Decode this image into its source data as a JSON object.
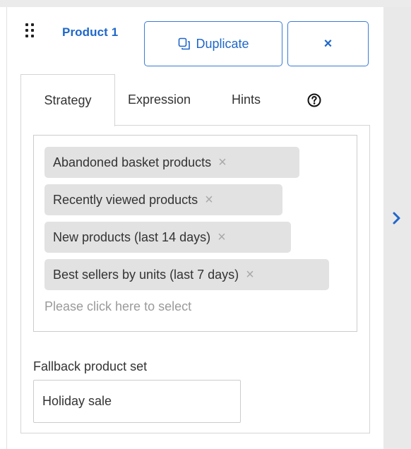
{
  "header": {
    "title": "Product 1",
    "duplicate_label": "Duplicate",
    "close_label": "×",
    "drag_icon": "drag-handle-icon",
    "duplicate_icon": "duplicate-icon"
  },
  "tabs": [
    {
      "label": "Strategy",
      "active": true
    },
    {
      "label": "Expression",
      "active": false
    },
    {
      "label": "Hints",
      "active": false
    }
  ],
  "help_icon": "question-circle-icon",
  "strategies": {
    "chips": [
      {
        "label": "Abandoned basket products",
        "remove": "×"
      },
      {
        "label": "Recently viewed products",
        "remove": "×"
      },
      {
        "label": "New products (last 14 days)",
        "remove": "×"
      },
      {
        "label": "Best sellers by units (last 7 days)",
        "remove": "×"
      }
    ],
    "placeholder": "Please click here to select"
  },
  "fallback": {
    "label": "Fallback product set",
    "value": "Holiday sale"
  },
  "side_toggle_icon": "chevron-right-icon",
  "colors": {
    "accent": "#1f67c9",
    "chip_bg": "#e2e2e2",
    "side_panel": "#e9e9e9"
  }
}
